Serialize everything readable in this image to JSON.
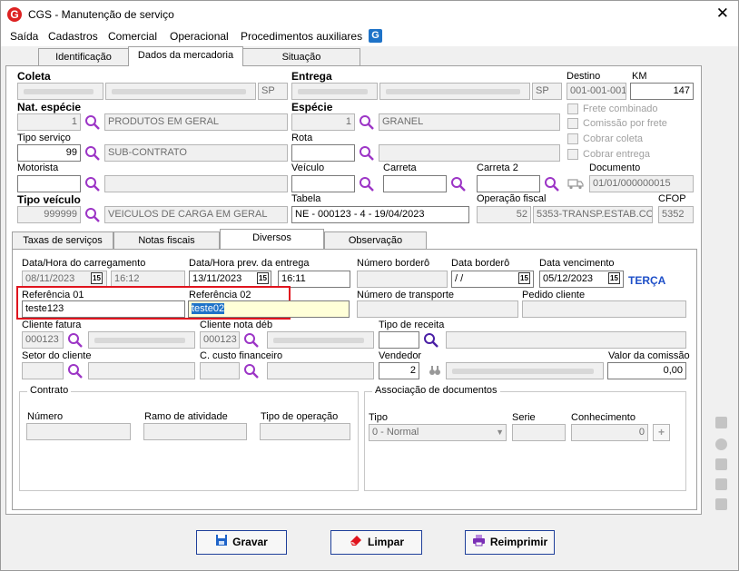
{
  "window": {
    "title": "CGS - Manutenção de serviço",
    "close": "✕"
  },
  "menu": [
    "Saída",
    "Cadastros",
    "Comercial",
    "Operacional",
    "Procedimentos auxiliares"
  ],
  "tabs": [
    "Identificação",
    "Dados da mercadoria",
    "Situação"
  ],
  "top": {
    "coleta_label": "Coleta",
    "coleta_uf": "SP",
    "entrega_label": "Entrega",
    "entrega_uf": "SP",
    "destino_label": "Destino",
    "destino_value": "001-001-001",
    "km_label": "KM",
    "km_value": "147",
    "nat_label": "Nat. espécie",
    "nat_code": "1",
    "nat_desc": "PRODUTOS EM GERAL",
    "especie_label": "Espécie",
    "especie_code": "1",
    "especie_desc": "GRANEL",
    "frete_combinado": "Frete combinado",
    "comissao_frete": "Comissão por frete",
    "cobrar_coleta": "Cobrar coleta",
    "cobrar_entrega": "Cobrar entrega",
    "tipo_servico_label": "Tipo serviço",
    "tipo_servico_code": "99",
    "tipo_servico_desc": "SUB-CONTRATO",
    "rota_label": "Rota",
    "motorista_label": "Motorista",
    "veiculo_label": "Veículo",
    "carreta_label": "Carreta",
    "carreta2_label": "Carreta 2",
    "documento_label": "Documento",
    "documento_value": "01/01/000000015",
    "tipo_veiculo_label": "Tipo veículo",
    "tipo_veiculo_code": "999999",
    "tipo_veiculo_desc": "VEICULOS DE CARGA EM GERAL",
    "tabela_label": "Tabela",
    "tabela_value": "NE - 000123 - 4 - 19/04/2023",
    "op_fiscal_label": "Operação fiscal",
    "op_fiscal_code": "52",
    "op_fiscal_desc": "5353-TRANSP.ESTAB.CO",
    "cfop_label": "CFOP",
    "cfop_value": "5352"
  },
  "subtabs": [
    "Taxas de serviços",
    "Notas fiscais",
    "Diversos",
    "Observação"
  ],
  "diversos": {
    "data_carreg_label": "Data/Hora do carregamento",
    "data_carreg": "08/11/2023",
    "hora_carreg": "16:12",
    "data_prev_label": "Data/Hora prev. da entrega",
    "data_prev": "13/11/2023",
    "hora_prev": "16:11",
    "num_bordero_label": "Número borderô",
    "data_bordero_label": "Data borderô",
    "data_bordero": " /  /",
    "data_venc_label": "Data vencimento",
    "data_venc": "05/12/2023",
    "dia_semana": "TERÇA",
    "ref01_label": "Referência 01",
    "ref01_value": "teste123",
    "ref02_label": "Referência 02",
    "ref02_value": "teste02",
    "num_transporte_label": "Número de transporte",
    "pedido_cliente_label": "Pedido cliente",
    "cliente_fatura_label": "Cliente fatura",
    "cliente_fatura_code": "000123",
    "cliente_nota_label": "Cliente nota déb",
    "cliente_nota_code": "000123",
    "tipo_receita_label": "Tipo de receita",
    "setor_label": "Setor do cliente",
    "custo_label": "C. custo financeiro",
    "vendedor_label": "Vendedor",
    "vendedor_code": "2",
    "comissao_label": "Valor da comissão",
    "comissao_value": "0,00",
    "contrato_title": "Contrato",
    "numero_label": "Número",
    "ramo_label": "Ramo de atividade",
    "tipo_op_label": "Tipo de operação",
    "assoc_title": "Associação de documentos",
    "tipo_label": "Tipo",
    "tipo_value": "0 - Normal",
    "serie_label": "Serie",
    "conhecimento_label": "Conhecimento",
    "conhecimento_value": "0"
  },
  "buttons": {
    "gravar": "Gravar",
    "limpar": "Limpar",
    "reimprimir": "Reimprimir"
  },
  "colors": {
    "accent": "#1e73c8",
    "highlight": "#e0141e",
    "magnifier": "#9c35c6"
  }
}
